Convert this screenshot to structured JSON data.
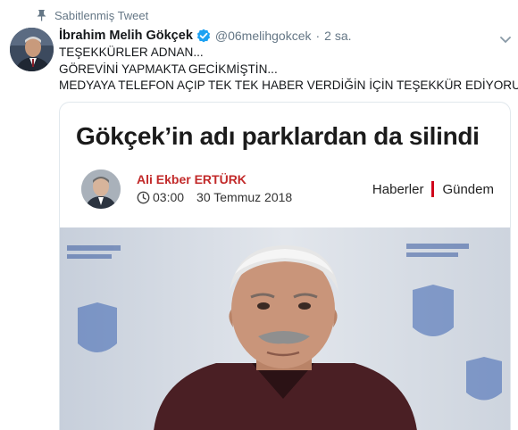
{
  "pinned": {
    "label": "Sabitlenmiş Tweet",
    "icon": "pin-icon"
  },
  "tweet": {
    "author_name": "İbrahim Melih Gökçek",
    "handle": "@06melihgokcek",
    "separator": "·",
    "timestamp": "2 sa.",
    "verified": true,
    "lines": [
      "TEŞEKKÜRLER ADNAN...",
      "GÖREVİNİ YAPMAKTA GECİKMİŞTİN...",
      "MEDYAYA TELEFON AÇIP TEK TEK HABER VERDİĞİN İÇİN TEŞEKKÜR EDİYORUM..."
    ]
  },
  "article": {
    "headline": "Gökçek’in adı parklardan da silindi",
    "author": "Ali Ekber ERTÜRK",
    "time": "03:00",
    "date": "30 Temmuz 2018",
    "sections": [
      "Haberler",
      "Gündem"
    ]
  },
  "colors": {
    "link_blue": "#1da1f2",
    "muted_gray": "#657786",
    "author_red": "#c22a2a",
    "divider_red": "#d0021b"
  }
}
